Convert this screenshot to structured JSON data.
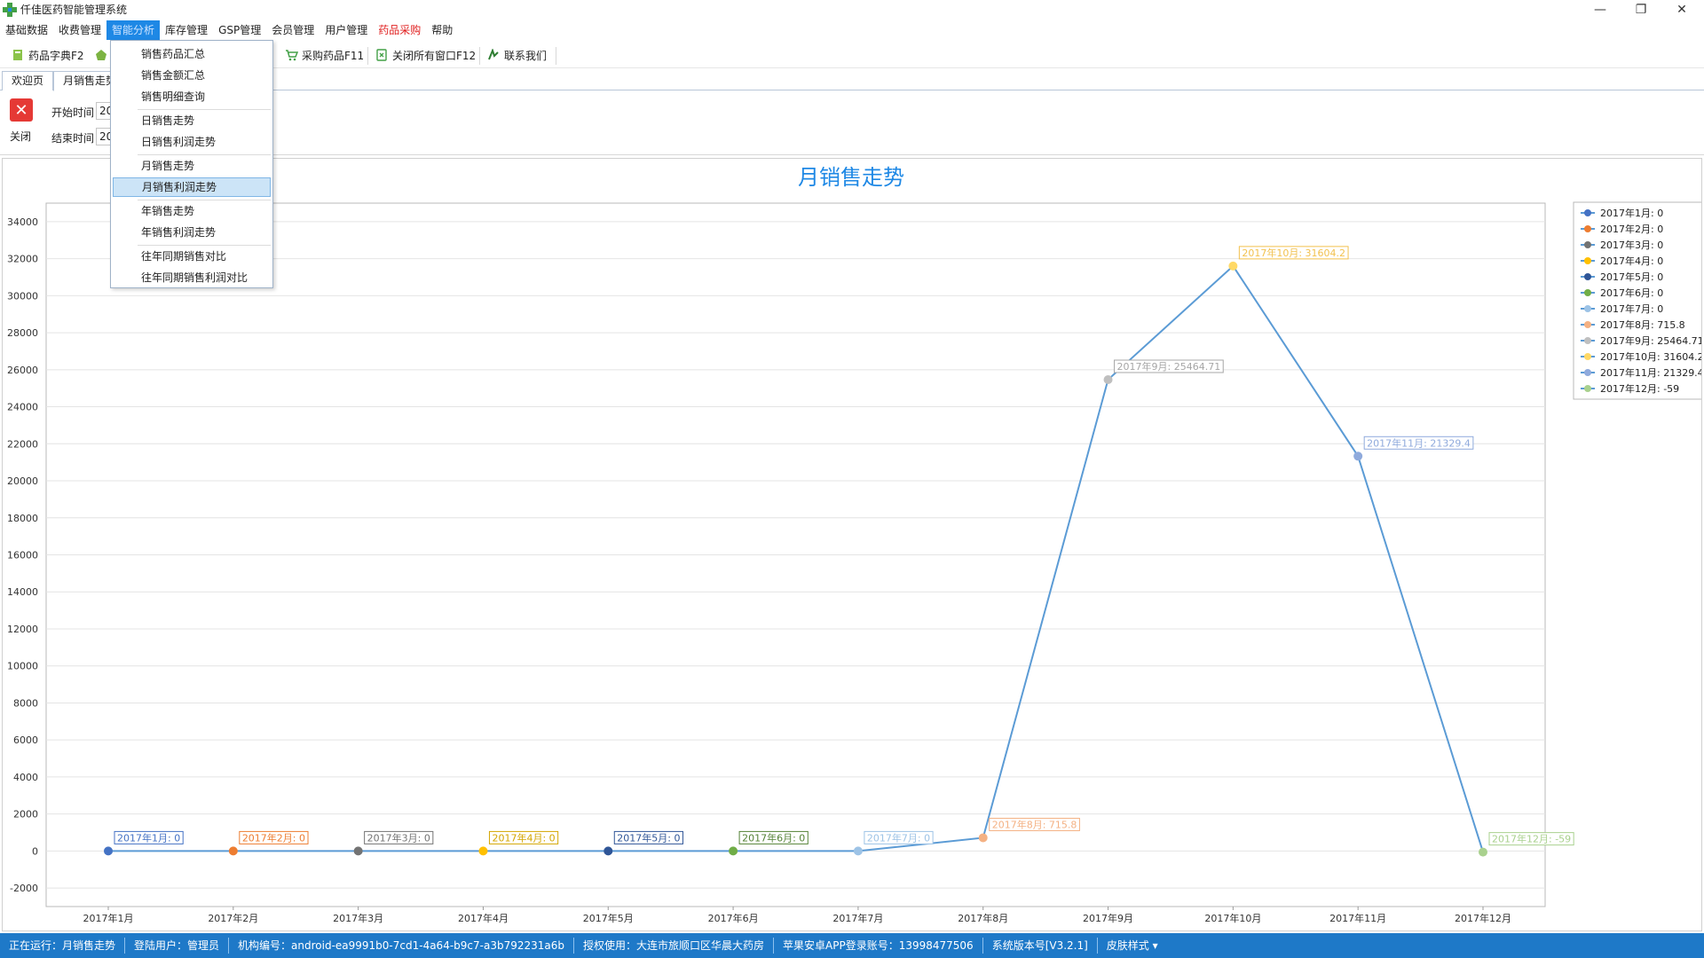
{
  "window": {
    "title": "仟佳医药智能管理系统",
    "minimize": "—",
    "maximize": "❐",
    "close": "✕"
  },
  "menu": [
    {
      "label": "基础数据"
    },
    {
      "label": "收费管理"
    },
    {
      "label": "智能分析",
      "active": true
    },
    {
      "label": "库存管理"
    },
    {
      "label": "GSP管理"
    },
    {
      "label": "会员管理"
    },
    {
      "label": "用户管理"
    },
    {
      "label": "药品采购",
      "red": true
    },
    {
      "label": "帮助"
    }
  ],
  "toolbar": {
    "drug_dict": "药品字典F2",
    "purchase": "采购药品F11",
    "close_all": "关闭所有窗口F12",
    "contact": "联系我们"
  },
  "tabs": [
    "欢迎页",
    "月销售走势"
  ],
  "filter": {
    "close_label": "关闭",
    "start_label": "开始时间",
    "end_label": "结束时间",
    "start_value": "20",
    "end_value": "20"
  },
  "dropdown": [
    {
      "label": "销售药品汇总"
    },
    {
      "label": "销售金额汇总"
    },
    {
      "label": "销售明细查询"
    },
    {
      "sep": true
    },
    {
      "label": "日销售走势"
    },
    {
      "label": "日销售利润走势"
    },
    {
      "sep": true
    },
    {
      "label": "月销售走势"
    },
    {
      "label": "月销售利润走势",
      "highlight": true
    },
    {
      "sep": true
    },
    {
      "label": "年销售走势"
    },
    {
      "label": "年销售利润走势"
    },
    {
      "sep": true
    },
    {
      "label": "往年同期销售对比"
    },
    {
      "label": "往年同期销售利润对比"
    }
  ],
  "status": {
    "running": "正在运行：月销售走势",
    "user": "登陆用户：管理员",
    "org": "机构编号：android-ea9991b0-7cd1-4a64-b9c7-a3b792231a6b",
    "license": "授权使用：大连市旅顺口区华晨大药房",
    "app_account": "苹果安卓APP登录账号：13998477506",
    "version": "系统版本号[V3.2.1]",
    "skin": "皮肤样式 ▾"
  },
  "chart_data": {
    "type": "line",
    "title": "月销售走势",
    "xlabel": "",
    "ylabel": "",
    "ylim": [
      -3000,
      35000
    ],
    "yticks": [
      -2000,
      0,
      2000,
      4000,
      6000,
      8000,
      10000,
      12000,
      14000,
      16000,
      18000,
      20000,
      22000,
      24000,
      26000,
      28000,
      30000,
      32000,
      34000
    ],
    "grid": true,
    "legend": "right",
    "categories": [
      "2017年1月",
      "2017年2月",
      "2017年3月",
      "2017年4月",
      "2017年5月",
      "2017年6月",
      "2017年7月",
      "2017年8月",
      "2017年9月",
      "2017年10月",
      "2017年11月",
      "2017年12月"
    ],
    "values": [
      0,
      0,
      0,
      0,
      0,
      0,
      0,
      715.8,
      25464.71,
      31604.2,
      21329.4,
      -59
    ],
    "value_labels": [
      "0",
      "0",
      "0",
      "0",
      "0",
      "0",
      "0",
      "715.8",
      "25464.71",
      "31604.2",
      "21329.4",
      "-59"
    ],
    "line_color": "#5b9bd5",
    "point_colors": [
      "#4472c4",
      "#ed7d31",
      "#737373",
      "#ffc000",
      "#2f5597",
      "#70ad47",
      "#9dc3e6",
      "#f4b183",
      "#bfbfbf",
      "#ffd966",
      "#8faadc",
      "#a9d18e"
    ],
    "label_colors": [
      "#4472c4",
      "#ed7d31",
      "#737373",
      "#d4a500",
      "#2f5597",
      "#548235",
      "#9dc3e6",
      "#f4b183",
      "#a6a6a6",
      "#f2c14e",
      "#8faadc",
      "#a9d18e"
    ]
  }
}
